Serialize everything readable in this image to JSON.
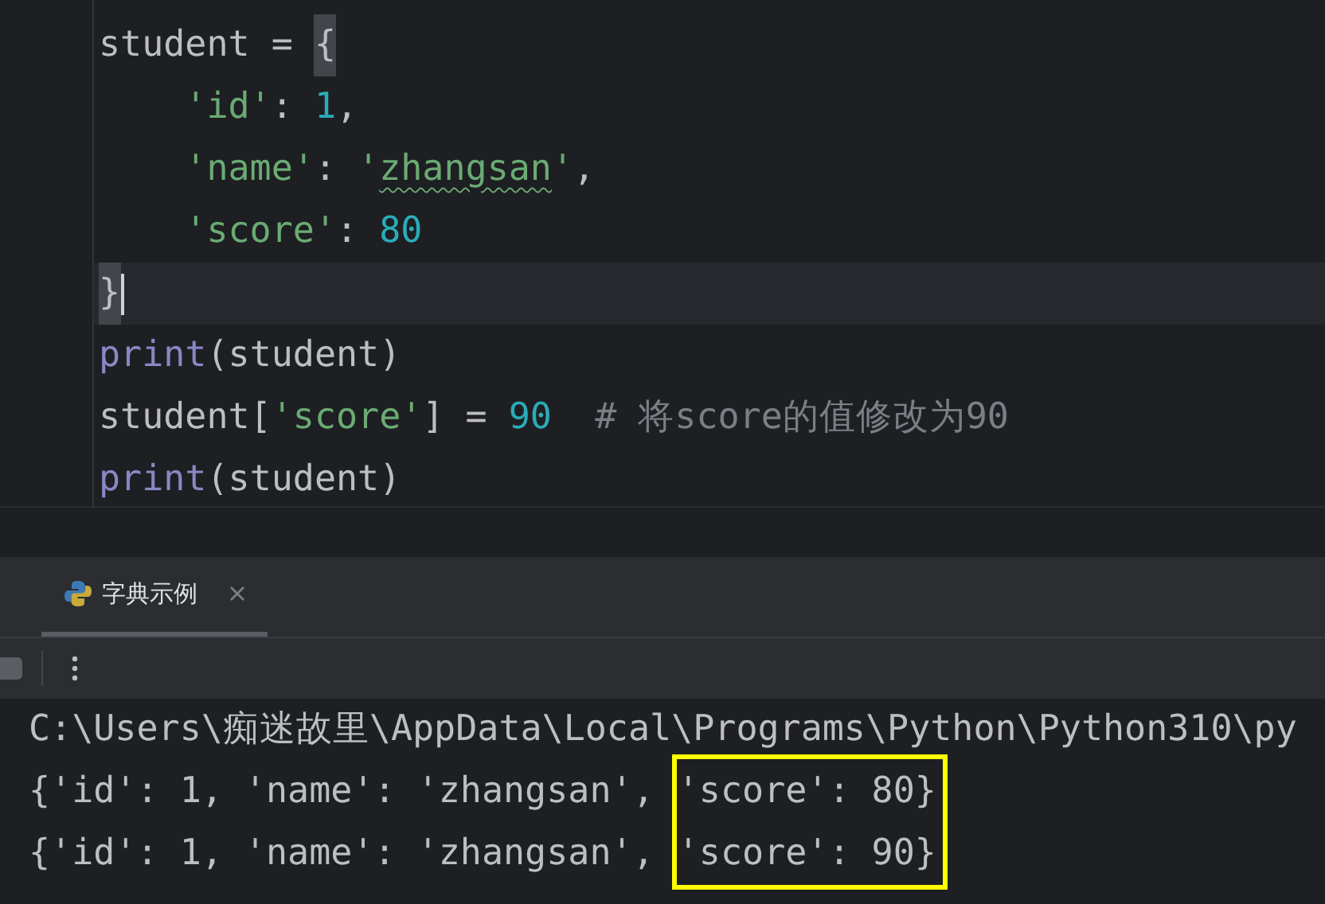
{
  "editor": {
    "lines": [
      {
        "current": false,
        "caret": false,
        "indented": false,
        "tokens": [
          {
            "kind": "plain",
            "text": "student = "
          },
          {
            "kind": "plain",
            "text": "{",
            "matched": true
          }
        ]
      },
      {
        "current": false,
        "caret": false,
        "indented": true,
        "tokens": [
          {
            "kind": "string",
            "text": "'id'"
          },
          {
            "kind": "plain",
            "text": ": "
          },
          {
            "kind": "number",
            "text": "1"
          },
          {
            "kind": "plain",
            "text": ","
          }
        ]
      },
      {
        "current": false,
        "caret": false,
        "indented": true,
        "tokens": [
          {
            "kind": "string",
            "text": "'name'"
          },
          {
            "kind": "plain",
            "text": ": "
          },
          {
            "kind": "string",
            "text": "'"
          },
          {
            "kind": "string",
            "text": "zhangsan",
            "typo": true
          },
          {
            "kind": "string",
            "text": "'"
          },
          {
            "kind": "plain",
            "text": ","
          }
        ]
      },
      {
        "current": false,
        "caret": false,
        "indented": true,
        "tokens": [
          {
            "kind": "string",
            "text": "'score'"
          },
          {
            "kind": "plain",
            "text": ": "
          },
          {
            "kind": "number",
            "text": "80"
          }
        ]
      },
      {
        "current": true,
        "caret": true,
        "indented": false,
        "tokens": [
          {
            "kind": "plain",
            "text": "}",
            "matched": true
          }
        ]
      },
      {
        "current": false,
        "caret": false,
        "indented": false,
        "tokens": [
          {
            "kind": "builtin",
            "text": "print"
          },
          {
            "kind": "plain",
            "text": "(student)"
          }
        ]
      },
      {
        "current": false,
        "caret": false,
        "indented": false,
        "tokens": [
          {
            "kind": "plain",
            "text": "student["
          },
          {
            "kind": "string",
            "text": "'score'"
          },
          {
            "kind": "plain",
            "text": "] = "
          },
          {
            "kind": "number",
            "text": "90"
          },
          {
            "kind": "comment",
            "text": "# 将score的值修改为90"
          }
        ]
      },
      {
        "current": false,
        "caret": false,
        "indented": false,
        "tokens": [
          {
            "kind": "builtin",
            "text": "print"
          },
          {
            "kind": "plain",
            "text": "(student)"
          }
        ]
      }
    ]
  },
  "run_panel": {
    "tabs": [
      {
        "label": "字典示例",
        "selected": true
      }
    ],
    "console": {
      "command": "C:\\Users\\痴迷故里\\AppData\\Local\\Programs\\Python\\Python310\\py",
      "output": [
        {
          "text": "{'id': 1, 'name': 'zhangsan', ",
          "marked": "'score': 80}"
        },
        {
          "text": "{'id': 1, 'name': 'zhangsan', ",
          "marked": "'score': 90}"
        }
      ]
    }
  }
}
